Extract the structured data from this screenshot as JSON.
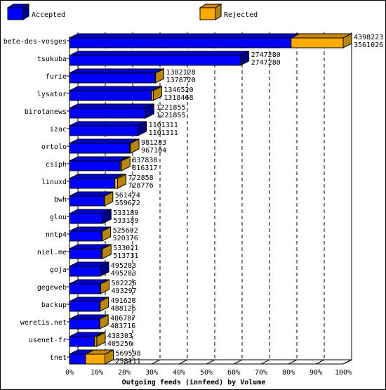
{
  "chart_data": {
    "type": "bar",
    "orientation": "horizontal",
    "stacked": true,
    "style": "3d",
    "xlabel": "Outgoing feeds (innfeed) by Volume",
    "xlim": [
      0,
      100
    ],
    "x_ticks": [
      "0%",
      "10%",
      "20%",
      "30%",
      "40%",
      "50%",
      "60%",
      "70%",
      "80%",
      "90%",
      "100%"
    ],
    "grid": true,
    "legend_position": "top",
    "colors": {
      "accepted": "#0000ff",
      "rejected": "#ffaa00",
      "rejected_side": "#b8860b",
      "accepted_side": "#00008b"
    },
    "series": [
      {
        "name": "Accepted"
      },
      {
        "name": "Rejected"
      }
    ],
    "categories": [
      "bete-des-vosges",
      "tsukuba",
      "furie",
      "lysator",
      "birotanews",
      "izac",
      "ortolo",
      "csiph",
      "linuxd",
      "bwh",
      "glou",
      "nntp4",
      "niel.me",
      "goja",
      "gegeweb",
      "backup",
      "weretis.net",
      "usenet-fr",
      "tnet"
    ],
    "offered": [
      4398223,
      2747280,
      1382128,
      1346520,
      1221855,
      1101311,
      981283,
      837838,
      772858,
      561474,
      533189,
      525602,
      533021,
      495283,
      502226,
      491628,
      486787,
      438303,
      569598
    ],
    "accepted": [
      3561026,
      2747280,
      1378720,
      1318468,
      1221855,
      1101311,
      967104,
      816317,
      728776,
      559672,
      533189,
      520376,
      513731,
      495283,
      493297,
      488126,
      483716,
      405256,
      258111
    ]
  }
}
